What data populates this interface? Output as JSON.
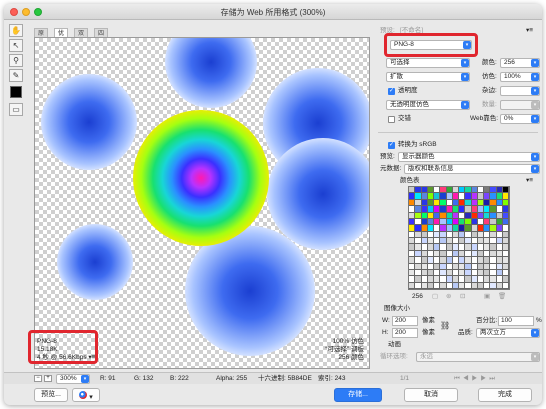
{
  "window": {
    "title": "存储为 Web 所用格式 (300%)"
  },
  "tabs": [
    "原稿",
    "优化",
    "双联",
    "四联"
  ],
  "image_info": {
    "format": "PNG-8",
    "size": "15.18K",
    "time": "4 秒 @ 56.6Kbps",
    "menu_glyph": "▾≡"
  },
  "image_info_right": {
    "quality": "100% 仿色",
    "palette": "“可选择” 调板",
    "colors": "256 颜色"
  },
  "panel": {
    "preset_label": "预设:",
    "preset_value": "[不命名]",
    "preset_menu_glyph": "▾≡",
    "format_value": "PNG-8",
    "reduction_value": "可选择",
    "colors_label": "颜色:",
    "colors_value": "256",
    "dither_value": "扩散",
    "dither_amount_label": "仿色:",
    "dither_amount_value": "100%",
    "transparency_label": "透明度",
    "transparency_checked": true,
    "matte_label": "杂边:",
    "transparency_dither_value": "无透明度仿色",
    "amount_label": "数量:",
    "interlaced_label": "交错",
    "interlaced_checked": false,
    "web_snap_label": "Web靠色:",
    "web_snap_value": "0%",
    "convert_srgb_label": "转换为 sRGB",
    "convert_srgb_checked": true,
    "preview_label": "预览:",
    "preview_value": "显示器颜色",
    "metadata_label": "元数据:",
    "metadata_value": "版权和联系信息",
    "color_table_label": "颜色表",
    "color_table_menu_glyph": "▾≡",
    "color_table_count": "256",
    "image_size_label": "图像大小",
    "width_label": "W:",
    "width_value": "200",
    "height_label": "H:",
    "height_value": "200",
    "px_unit": "像素",
    "percent_label": "百分比:",
    "percent_value": "100",
    "percent_unit": "%",
    "quality_label": "品质:",
    "quality_value": "两次立方",
    "animation_label": "动画",
    "loop_label": "循环选项:",
    "loop_value": "永远",
    "frame_counter": "1/1"
  },
  "statusbar": {
    "zoom": "300%",
    "r": "R: 91",
    "g": "G: 132",
    "b": "B: 222",
    "alpha": "Alpha: 255",
    "hex": "十六进制: 5B84DE",
    "index": "索引: 243"
  },
  "buttons": {
    "preview": "预览...",
    "save": "存储...",
    "cancel": "取消",
    "done": "完成"
  },
  "colors": {
    "accent": "#2d7cf6",
    "highlight_box": "#e0262e"
  },
  "color_table_cells": [
    "#c9c9c9",
    "#2a36e8",
    "#2a36e8",
    "#5b9a2c",
    "#ffffff",
    "#ff3b7a",
    "#34a834",
    "#d9d9d9",
    "#00c7ff",
    "#12d8a2",
    "#5b84de",
    "#ffffff",
    "#7a7a7a",
    "#444cff",
    "#2b2bb8",
    "#000000",
    "#2c2cff",
    "#00e8ff",
    "#5b84de",
    "#7fff00",
    "#17c4d8",
    "#1b3fd1",
    "#a9c4ff",
    "#ff19b0",
    "#ffffff",
    "#3a30ff",
    "#b832ff",
    "#c9c9c9",
    "#7a44ff",
    "#2a90ff",
    "#18e070",
    "#ffe800",
    "#ff8a00",
    "#d9d9d9",
    "#2a36e8",
    "#5b9a2c",
    "#ffe800",
    "#00ff6a",
    "#ffffff",
    "#3e6bf0",
    "#ff2a00",
    "#18d6d6",
    "#b832ff",
    "#a6ff10",
    "#1a1aa8",
    "#ff8a00",
    "#2a90ff",
    "#7fff00",
    "#ffffff",
    "#5b84de",
    "#3a30ff",
    "#00c7ff",
    "#d900ff",
    "#1b3fd1",
    "#ff19b0",
    "#18e070",
    "#2c2cff",
    "#c9c9c9",
    "#ff3b7a",
    "#9fc0ff",
    "#00e8ff",
    "#5b9a2c",
    "#ffffff",
    "#2a36e8",
    "#d9d9d9",
    "#a6ff10",
    "#00ff6a",
    "#ffe800",
    "#3e6bf0",
    "#ff8a00",
    "#12d8a2",
    "#b832ff",
    "#ffffff",
    "#2b2bb8",
    "#ff2a00",
    "#7a44ff",
    "#18d6d6",
    "#2a90ff",
    "#c9c9c9",
    "#444cff",
    "#3a30ff",
    "#ffffff",
    "#1b3fd1",
    "#5b84de",
    "#ff19b0",
    "#a9c4ff",
    "#00c7ff",
    "#d900ff",
    "#18e070",
    "#7fff00",
    "#2a36e8",
    "#ffffff",
    "#ff3b7a",
    "#c9c9c9",
    "#34a834",
    "#3e6bf0",
    "#ffe800",
    "#2c2cff",
    "#ff8a00",
    "#00e8ff",
    "#ffffff",
    "#b832ff",
    "#9fc0ff",
    "#12d8a2",
    "#1a1aa8",
    "#5b9a2c",
    "#d9d9d9",
    "#ff2a00",
    "#2a90ff",
    "#a6ff10",
    "#7a44ff",
    "#ffffff",
    "#ffffff",
    "#d9d9d9",
    "#c9c9c9",
    "#ffffff",
    "#e0e8ff",
    "#c9d6ff",
    "#ffffff",
    "#d9d9d9",
    "#b7c8f5",
    "#ffffff",
    "#c9c9c9",
    "#e6e6e6",
    "#ffffff",
    "#d9d9d9",
    "#ffffff",
    "#c9c9c9",
    "#d9d9d9",
    "#ffffff",
    "#c9d6ff",
    "#e6e6e6",
    "#ffffff",
    "#b7c8f5",
    "#d9d9d9",
    "#ffffff",
    "#c9c9c9",
    "#e0e8ff",
    "#ffffff",
    "#d9d9d9",
    "#e6e6e6",
    "#ffffff",
    "#c9d6ff",
    "#d9d9d9",
    "#c9c9c9",
    "#e6e6e6",
    "#ffffff",
    "#d9d9d9",
    "#b7c8f5",
    "#ffffff",
    "#c9c9c9",
    "#e0e8ff",
    "#ffffff",
    "#d9d9d9",
    "#c9d6ff",
    "#ffffff",
    "#e6e6e6",
    "#c9c9c9",
    "#ffffff",
    "#d9d9d9",
    "#ffffff",
    "#c9d6ff",
    "#d9d9d9",
    "#ffffff",
    "#e6e6e6",
    "#c9c9c9",
    "#ffffff",
    "#b7c8f5",
    "#d9d9d9",
    "#ffffff",
    "#e0e8ff",
    "#c9c9c9",
    "#ffffff",
    "#d9d9d9",
    "#e6e6e6",
    "#ffffff",
    "#d9d9d9",
    "#ffffff",
    "#c9c9c9",
    "#e0e8ff",
    "#ffffff",
    "#d9d9d9",
    "#b7c8f5",
    "#ffffff",
    "#c9d6ff",
    "#e6e6e6",
    "#ffffff",
    "#d9d9d9",
    "#c9c9c9",
    "#ffffff",
    "#d9d9d9",
    "#e6e6e6",
    "#ffffff",
    "#d9d9d9",
    "#e6e6e6",
    "#ffffff",
    "#c9c9c9",
    "#c9d6ff",
    "#ffffff",
    "#d9d9d9",
    "#e6e6e6",
    "#b7c8f5",
    "#ffffff",
    "#c9c9c9",
    "#d9d9d9",
    "#ffffff",
    "#e0e8ff",
    "#d9d9d9",
    "#e6e6e6",
    "#ffffff",
    "#d9d9d9",
    "#c9c9c9",
    "#ffffff",
    "#e0e8ff",
    "#d9d9d9",
    "#ffffff",
    "#e6e6e6",
    "#c9d6ff",
    "#ffffff",
    "#d9d9d9",
    "#c9c9c9",
    "#ffffff",
    "#b7c8f5",
    "#ffffff",
    "#ffffff",
    "#c9c9c9",
    "#ffffff",
    "#d9d9d9",
    "#e6e6e6",
    "#ffffff",
    "#c9d6ff",
    "#d9d9d9",
    "#ffffff",
    "#c9c9c9",
    "#e0e8ff",
    "#ffffff",
    "#d9d9d9",
    "#e6e6e6",
    "#ffffff",
    "#c9c9c9",
    "#d9d9d9",
    "#ffffff",
    "#e6e6e6",
    "#c9c9c9",
    "#ffffff",
    "#d9d9d9",
    "#ffffff",
    "#b7c8f5",
    "#e6e6e6",
    "#ffffff",
    "#d9d9d9",
    "#c9c9c9",
    "#ffffff",
    "#e0e8ff",
    "#d9d9d9",
    "#ffffff"
  ]
}
